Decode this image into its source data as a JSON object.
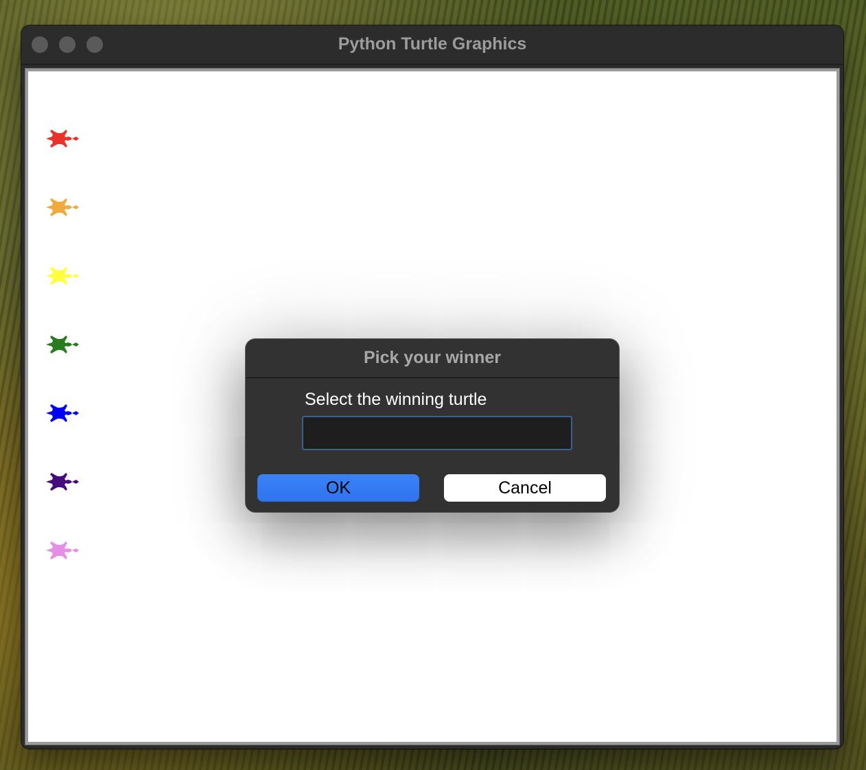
{
  "window": {
    "title": "Python Turtle Graphics"
  },
  "canvas": {
    "background": "#ffffff",
    "turtles": [
      {
        "name": "red",
        "color": "#e8322a"
      },
      {
        "name": "orange",
        "color": "#f0a93a"
      },
      {
        "name": "yellow",
        "color": "#ffff40"
      },
      {
        "name": "green",
        "color": "#2a7a1f"
      },
      {
        "name": "blue",
        "color": "#0000f2"
      },
      {
        "name": "purple",
        "color": "#450a7e"
      },
      {
        "name": "violet",
        "color": "#e48ee8"
      }
    ]
  },
  "dialog": {
    "title": "Pick your winner",
    "prompt": "Select the winning turtle",
    "input_value": "",
    "ok_label": "OK",
    "cancel_label": "Cancel",
    "accent_color": "#3b82f6"
  }
}
